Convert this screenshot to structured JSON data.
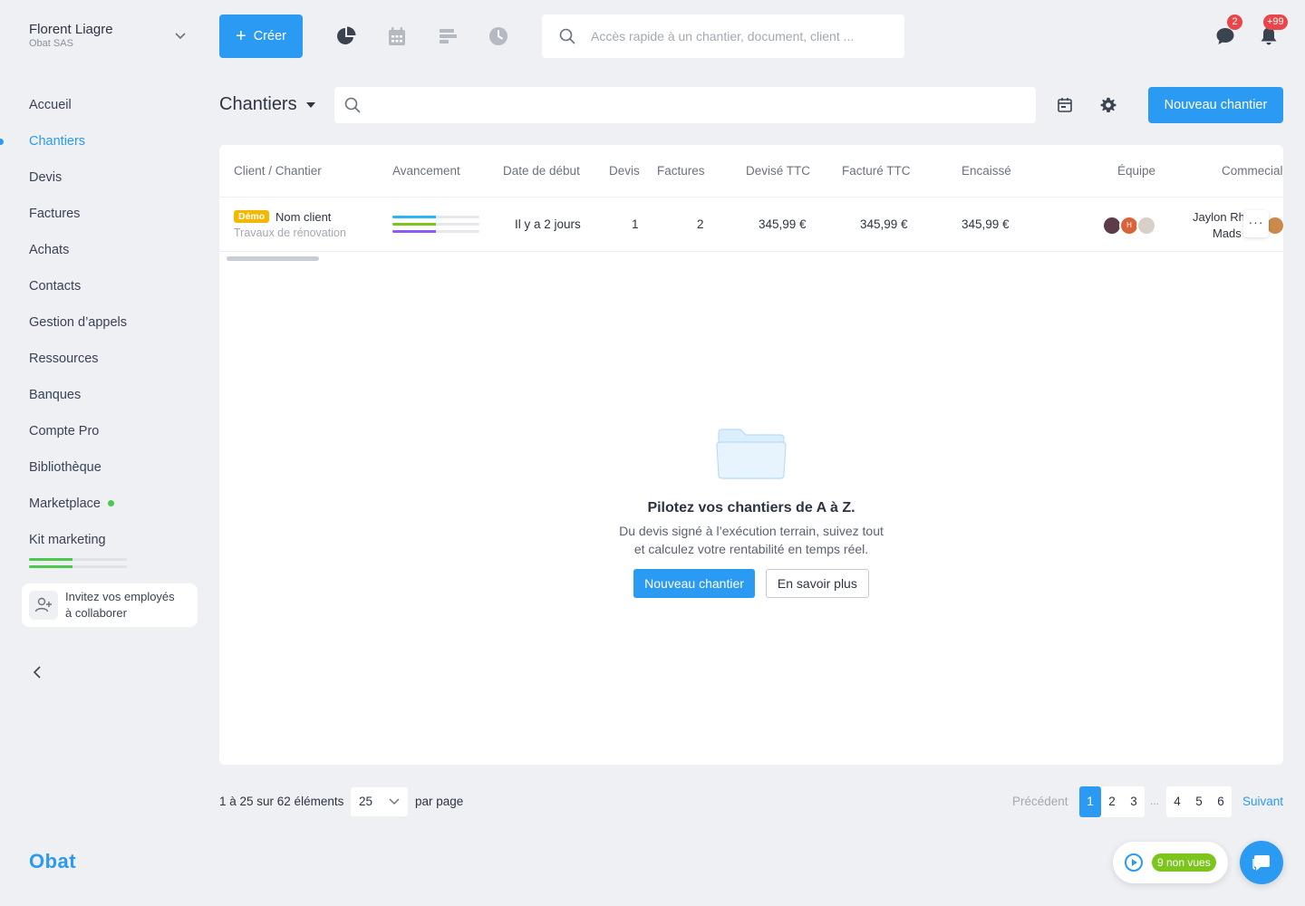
{
  "account": {
    "name": "Florent Liagre",
    "company": "Obat SAS"
  },
  "nav": {
    "items": [
      {
        "label": "Accueil"
      },
      {
        "label": "Chantiers",
        "active": true
      },
      {
        "label": "Devis"
      },
      {
        "label": "Factures"
      },
      {
        "label": "Achats"
      },
      {
        "label": "Contacts"
      },
      {
        "label": "Gestion d’appels"
      },
      {
        "label": "Ressources"
      },
      {
        "label": "Banques"
      },
      {
        "label": "Compte Pro"
      },
      {
        "label": "Bibliothèque"
      },
      {
        "label": "Marketplace",
        "dot_color": "#4cc94c"
      },
      {
        "label": "Kit marketing"
      }
    ],
    "kit_progress": [
      0.44,
      0.44
    ]
  },
  "invite": {
    "line1": "Invitez vos employés",
    "line2": "à collaborer"
  },
  "brand": {
    "logo": "Obat",
    "accent": "#2b9af3"
  },
  "topbar": {
    "create_label": "Créer",
    "icons": [
      "chart-pie-icon",
      "calendar-icon",
      "gantt-icon",
      "clock-icon"
    ],
    "search_placeholder": "Accès rapide à un chantier, document, client ...",
    "messages_badge": "2",
    "notifications_badge": "+99"
  },
  "page": {
    "title": "Chantiers",
    "new_button": "Nouveau chantier"
  },
  "table": {
    "columns": [
      "Client / Chantier",
      "Avancement",
      "Date de début",
      "Devis",
      "Factures",
      "Devisé TTC",
      "Facturé TTC",
      "Encaissé",
      "Équipe",
      "Commecial"
    ],
    "rows": [
      {
        "badge": "Démo",
        "client": "Nom client",
        "chantier": "Travaux de rénovation",
        "progress": [
          {
            "value": 0.5,
            "color": "#29b7f0"
          },
          {
            "value": 0.5,
            "color": "#7cc51c"
          },
          {
            "value": 0.5,
            "color": "#8b5cf6"
          }
        ],
        "start": "Il y a 2 jours",
        "devis": "1",
        "factures": "2",
        "devise_ttc": "345,99 €",
        "facture_ttc": "345,99 €",
        "encaisse": "345,99 €",
        "equipe_initial": "H",
        "commercial_line1": "Jaylon Rh",
        "commercial_line2": "Mads"
      }
    ],
    "more_label": "···"
  },
  "empty_state": {
    "title": "Pilotez vos chantiers de A à Z.",
    "line1": "Du devis signé à l’exécution terrain, suivez tout",
    "line2": "et calculez votre rentabilité en temps réel.",
    "primary": "Nouveau chantier",
    "secondary": "En savoir plus"
  },
  "pagination": {
    "info": "1 à 25 sur 62 éléments",
    "per_page_value": "25",
    "per_page_label": "par page",
    "prev": "Précédent",
    "pages_a": [
      "1",
      "2",
      "3"
    ],
    "dots": "...",
    "pages_b": [
      "4",
      "5",
      "6"
    ],
    "next": "Suivant",
    "current": "1"
  },
  "widgets": {
    "videos_unseen": "9 non vues"
  }
}
